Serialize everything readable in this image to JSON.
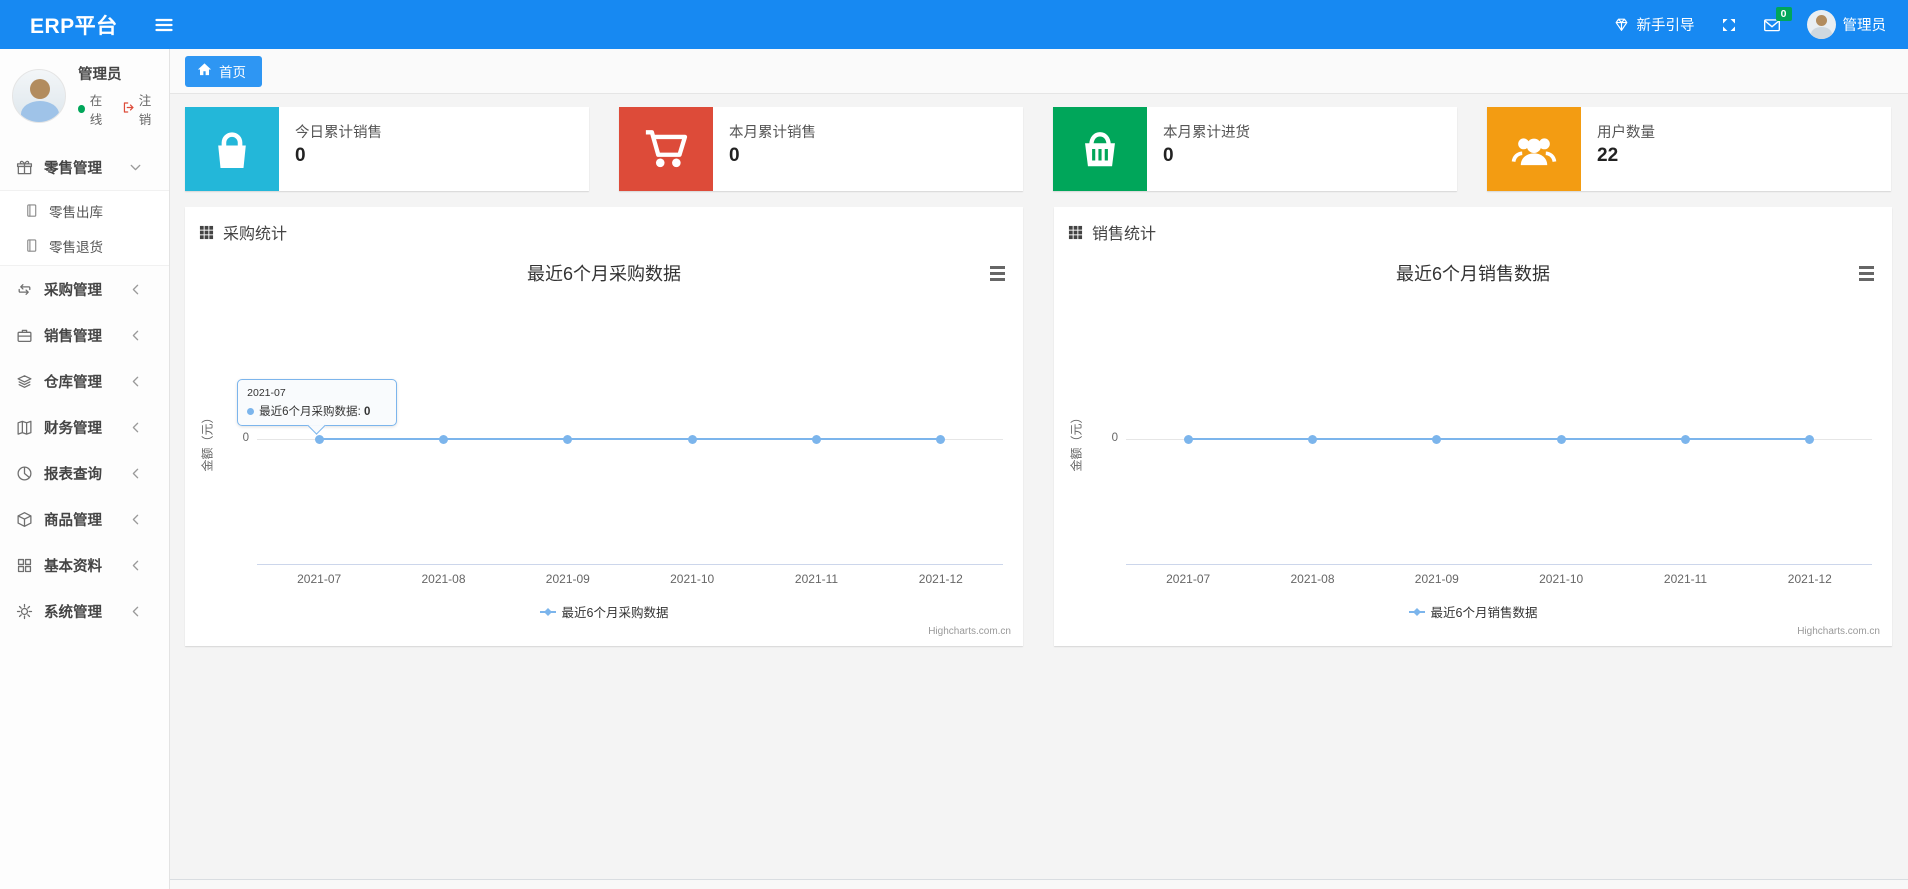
{
  "colors": {
    "accent_blue": "#1789f2",
    "series_line": "#7cb5ec",
    "badge_green": "#00a65a"
  },
  "navbar": {
    "brand": "ERP平台",
    "menu_toggle_icon": "hamburger-icon",
    "guide": {
      "icon": "gem-icon",
      "label": "新手引导"
    },
    "fullscreen_icon": "expand-icon",
    "messages": {
      "icon": "envelope-icon",
      "badge": "0"
    },
    "user": {
      "avatar_icon": "avatar",
      "name": "管理员"
    }
  },
  "sidebar": {
    "user": {
      "name": "管理员",
      "status_label": "在线",
      "logout_label": "注销",
      "logout_icon": "sign-out-icon"
    },
    "menu": [
      {
        "label": "零售管理",
        "icon": "gift-icon",
        "state": "expanded",
        "chevron": "chevron-down-icon",
        "children": [
          {
            "label": "零售出库",
            "icon": "file-icon"
          },
          {
            "label": "零售退货",
            "icon": "file-icon"
          }
        ]
      },
      {
        "label": "采购管理",
        "icon": "repeat-icon",
        "chevron": "chevron-left-icon"
      },
      {
        "label": "销售管理",
        "icon": "briefcase-icon",
        "chevron": "chevron-left-icon"
      },
      {
        "label": "仓库管理",
        "icon": "layers-icon",
        "chevron": "chevron-left-icon"
      },
      {
        "label": "财务管理",
        "icon": "book-icon",
        "chevron": "chevron-left-icon"
      },
      {
        "label": "报表查询",
        "icon": "pie-chart-icon",
        "chevron": "chevron-left-icon"
      },
      {
        "label": "商品管理",
        "icon": "box-icon",
        "chevron": "chevron-left-icon"
      },
      {
        "label": "基本资料",
        "icon": "grid-icon",
        "chevron": "chevron-left-icon"
      },
      {
        "label": "系统管理",
        "icon": "gear-icon",
        "chevron": "chevron-left-icon"
      }
    ]
  },
  "tabs": {
    "home": {
      "icon": "home-icon",
      "label": "首页"
    }
  },
  "stat_cards": [
    {
      "label": "今日累计销售",
      "value": "0",
      "icon": "shopping-bag-icon",
      "color": "#23b7d9"
    },
    {
      "label": "本月累计销售",
      "value": "0",
      "icon": "cart-icon",
      "color": "#dd4b39"
    },
    {
      "label": "本月累计进货",
      "value": "0",
      "icon": "basket-icon",
      "color": "#00a65a"
    },
    {
      "label": "用户数量",
      "value": "22",
      "icon": "users-icon",
      "color": "#f39c12"
    }
  ],
  "chart_data": [
    {
      "type": "line",
      "panel_title": "采购统计",
      "panel_icon": "th-grid-icon",
      "title": "最近6个月采购数据",
      "categories": [
        "2021-07",
        "2021-08",
        "2021-09",
        "2021-10",
        "2021-11",
        "2021-12"
      ],
      "series": [
        {
          "name": "最近6个月采购数据",
          "values": [
            0,
            0,
            0,
            0,
            0,
            0
          ],
          "color": "#7cb5ec"
        }
      ],
      "ylabel": "金额（元）",
      "yticks": [
        "0"
      ],
      "ylim": [
        0,
        1
      ],
      "grid": true,
      "legend_position": "bottom",
      "credits": "Highcharts.com.cn",
      "context_menu_icon": "hamburger-icon",
      "tooltip": {
        "visible": true,
        "category": "2021-07",
        "series": "最近6个月采购数据",
        "separator": ": ",
        "value": "0"
      }
    },
    {
      "type": "line",
      "panel_title": "销售统计",
      "panel_icon": "th-grid-icon",
      "title": "最近6个月销售数据",
      "categories": [
        "2021-07",
        "2021-08",
        "2021-09",
        "2021-10",
        "2021-11",
        "2021-12"
      ],
      "series": [
        {
          "name": "最近6个月销售数据",
          "values": [
            0,
            0,
            0,
            0,
            0,
            0
          ],
          "color": "#7cb5ec"
        }
      ],
      "ylabel": "金额（元）",
      "yticks": [
        "0"
      ],
      "ylim": [
        0,
        1
      ],
      "grid": true,
      "legend_position": "bottom",
      "credits": "Highcharts.com.cn",
      "context_menu_icon": "hamburger-icon",
      "tooltip": {
        "visible": false
      }
    }
  ]
}
